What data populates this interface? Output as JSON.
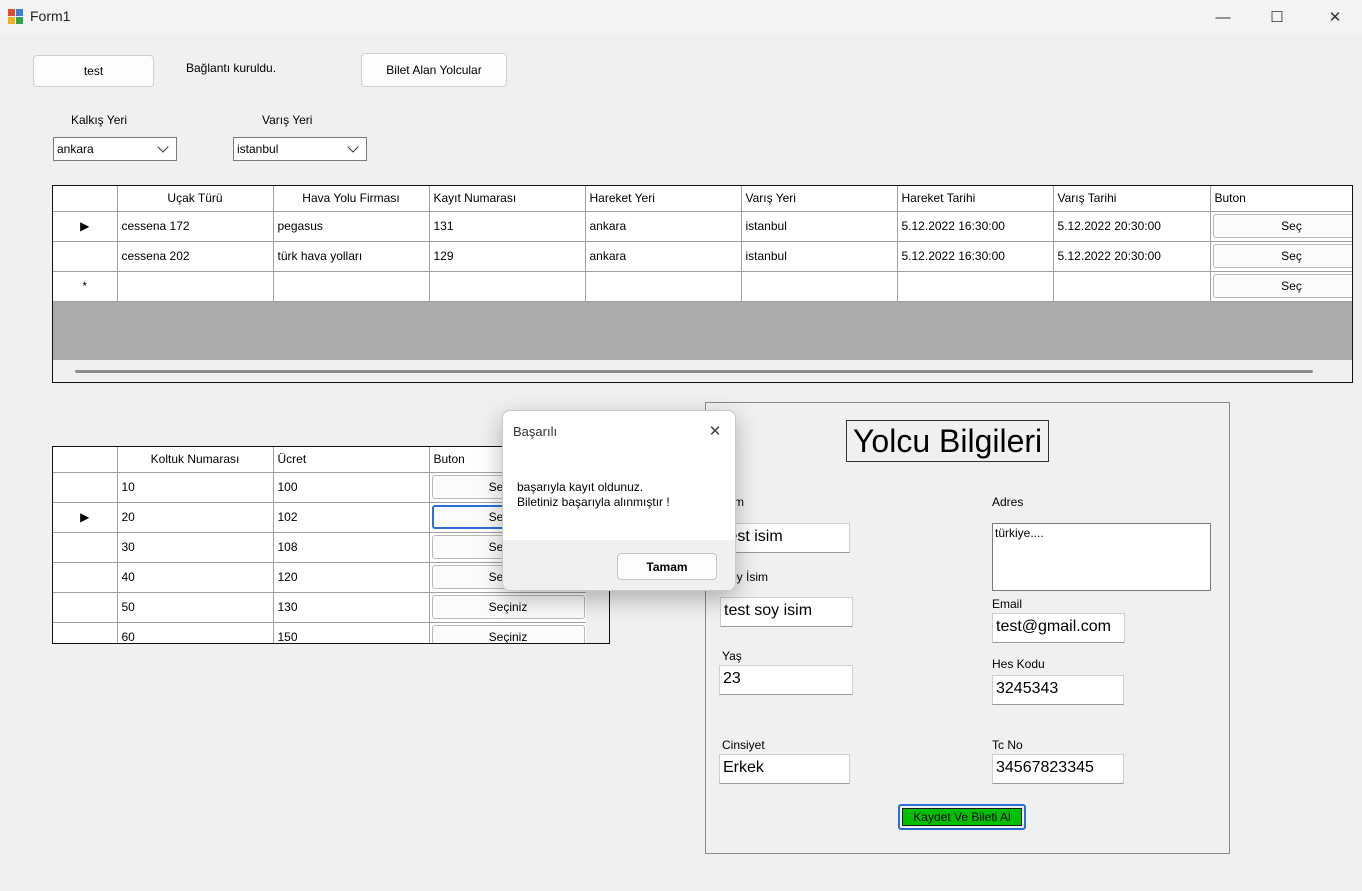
{
  "window": {
    "title": "Form1",
    "minimize": "—",
    "maximize": "☐",
    "close": "✕"
  },
  "top": {
    "test_button": "test",
    "status": "Bağlantı kuruldu.",
    "passengers_button": "Bilet Alan Yolcular"
  },
  "filters": {
    "departure_label": "Kalkış Yeri",
    "departure_value": "ankara",
    "arrival_label": "Varış Yeri",
    "arrival_value": "istanbul"
  },
  "flights": {
    "columns": [
      "Uçak Türü",
      "Hava Yolu Firması",
      "Kayıt Numarası",
      "Hareket Yeri",
      "Varış Yeri",
      "Hareket Tarihi",
      "Varış Tarihi",
      "Buton"
    ],
    "rows": [
      {
        "marker": "▶",
        "cells": [
          "cessena 172",
          "pegasus",
          "131",
          "ankara",
          "istanbul",
          "5.12.2022 16:30:00",
          "5.12.2022 20:30:00"
        ],
        "button": "Seç"
      },
      {
        "marker": "",
        "cells": [
          "cessena 202",
          "türk hava yolları",
          "129",
          "ankara",
          "istanbul",
          "5.12.2022 16:30:00",
          "5.12.2022 20:30:00"
        ],
        "button": "Seç"
      },
      {
        "marker": "*",
        "cells": [
          "",
          "",
          "",
          "",
          "",
          "",
          ""
        ],
        "button": "Seç"
      }
    ]
  },
  "seats": {
    "columns": [
      "Koltuk Numarası",
      "Ücret",
      "Buton"
    ],
    "rows": [
      {
        "marker": "",
        "cells": [
          "10",
          "100"
        ],
        "button": "Seçiniz"
      },
      {
        "marker": "▶",
        "cells": [
          "20",
          "102"
        ],
        "button": "Seçiniz"
      },
      {
        "marker": "",
        "cells": [
          "30",
          "108"
        ],
        "button": "Seçiniz"
      },
      {
        "marker": "",
        "cells": [
          "40",
          "120"
        ],
        "button": "Seçiniz"
      },
      {
        "marker": "",
        "cells": [
          "50",
          "130"
        ],
        "button": "Seçiniz"
      },
      {
        "marker": "",
        "cells": [
          "60",
          "150"
        ],
        "button": "Seçiniz"
      }
    ]
  },
  "passenger": {
    "title": "Yolcu Bilgileri",
    "name_label": "İsim",
    "name_value": "test isim",
    "surname_label": "Soy İsim",
    "surname_value": "test soy isim",
    "age_label": "Yaş",
    "age_value": "23",
    "gender_label": "Cinsiyet",
    "gender_value": "Erkek",
    "address_label": "Adres",
    "address_value": "türkiye....",
    "email_label": "Email",
    "email_value": "test@gmail.com",
    "hes_label": "Hes Kodu",
    "hes_value": "3245343",
    "tc_label": "Tc No",
    "tc_value": "34567823345",
    "submit_label": "Kaydet Ve Bileti Al",
    "submit_color": "#00c000"
  },
  "dialog": {
    "title": "Başarılı",
    "line1": "başarıyla kayıt oldunuz.",
    "line2": "Biletiniz başarıyla alınmıştır !",
    "ok": "Tamam"
  }
}
